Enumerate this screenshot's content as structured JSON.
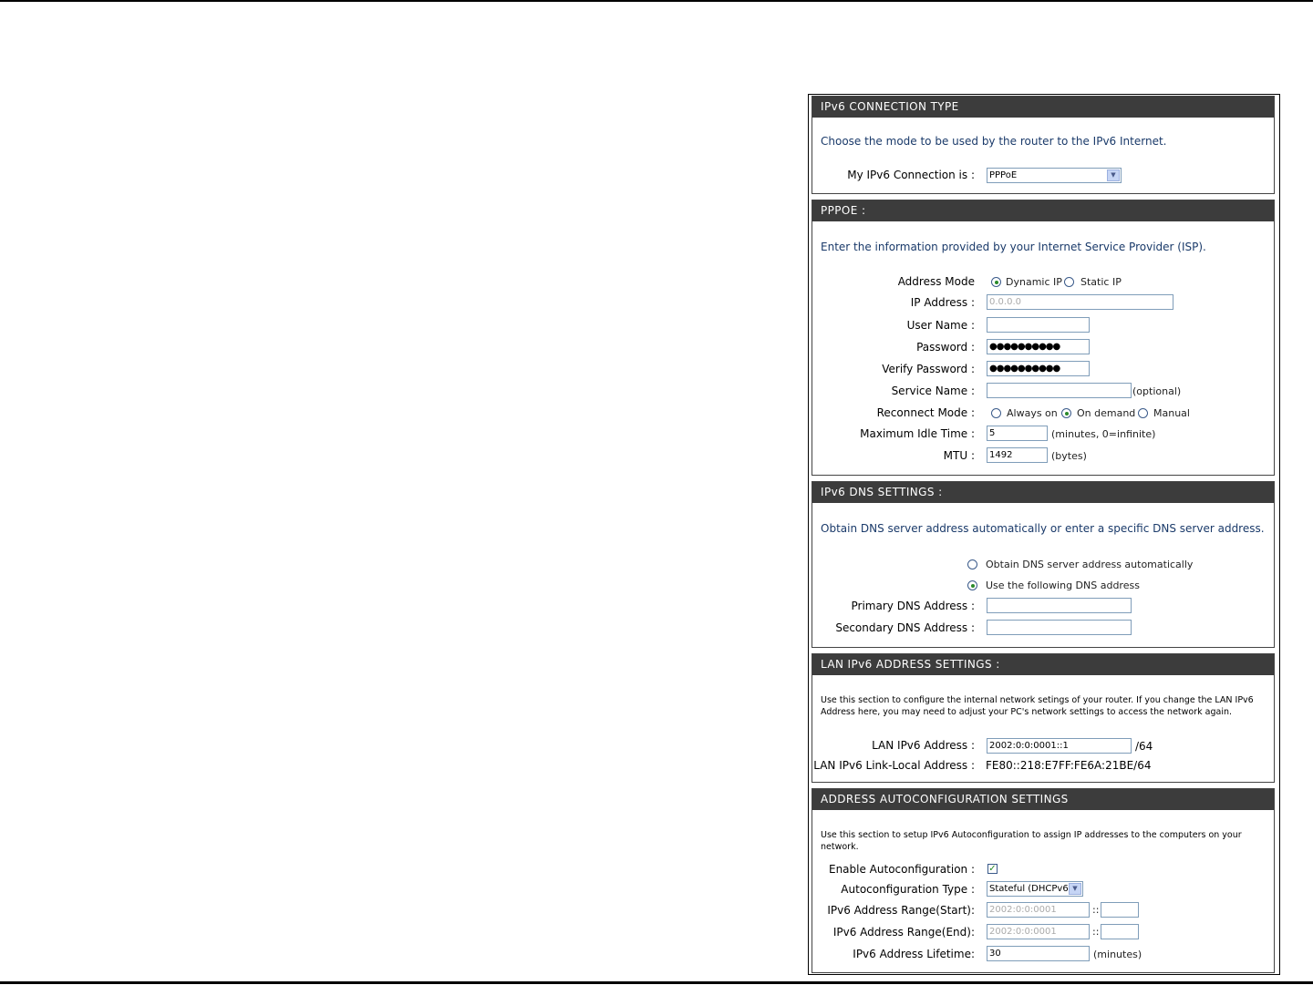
{
  "connection_type": {
    "header": "IPv6 CONNECTION TYPE",
    "intro": "Choose the mode to be used by the router to the IPv6 Internet.",
    "label": "My IPv6 Connection is :",
    "value": "PPPoE"
  },
  "pppoe": {
    "header": "PPPOE :",
    "intro": "Enter the information provided by your Internet Service Provider (ISP).",
    "address_mode_label": "Address Mode",
    "address_mode_options": [
      "Dynamic IP",
      "Static IP"
    ],
    "address_mode_selected": "Dynamic IP",
    "ip_address_label": "IP Address :",
    "ip_address_value": "0.0.0.0",
    "user_name_label": "User Name :",
    "user_name_value": "",
    "password_label": "Password :",
    "password_value": "●●●●●●●●●●",
    "verify_password_label": "Verify Password :",
    "verify_password_value": "●●●●●●●●●●",
    "service_name_label": "Service Name :",
    "service_name_value": "",
    "service_name_hint": "(optional)",
    "reconnect_mode_label": "Reconnect Mode :",
    "reconnect_options": [
      "Always on",
      "On demand",
      "Manual"
    ],
    "reconnect_selected": "On demand",
    "max_idle_label": "Maximum Idle Time :",
    "max_idle_value": "5",
    "max_idle_hint": "(minutes, 0=infinite)",
    "mtu_label": "MTU :",
    "mtu_value": "1492",
    "mtu_hint": "(bytes)"
  },
  "dns": {
    "header": "IPv6 DNS SETTINGS :",
    "intro": "Obtain DNS server address automatically or enter a specific DNS server address.",
    "options": [
      "Obtain DNS server address automatically",
      "Use the following DNS address"
    ],
    "selected": "Use the following DNS address",
    "primary_label": "Primary DNS Address :",
    "primary_value": "",
    "secondary_label": "Secondary DNS Address :",
    "secondary_value": ""
  },
  "lan": {
    "header": "LAN IPv6 ADDRESS SETTINGS :",
    "intro": "Use this section to configure the internal network setings of your router. If you change the LAN IPv6 Address here, you may need to adjust your PC's network settings to access the network again.",
    "address_label": "LAN IPv6 Address :",
    "address_value": "2002:0:0:0001::1",
    "prefix": "/64",
    "link_local_label": "LAN IPv6 Link-Local Address :",
    "link_local_value": "FE80::218:E7FF:FE6A:21BE/64"
  },
  "autoconf": {
    "header": "ADDRESS AUTOCONFIGURATION SETTINGS",
    "intro": "Use this section to setup IPv6 Autoconfiguration to assign IP addresses to the computers on your network.",
    "enable_label": "Enable Autoconfiguration :",
    "enable_checked": true,
    "type_label": "Autoconfiguration Type :",
    "type_value": "Stateful (DHCPv6)",
    "range_start_label": "IPv6 Address Range(Start):",
    "range_start_prefix": "2002:0:0:0001",
    "range_start_suffix": "",
    "range_end_label": "IPv6 Address Range(End):",
    "range_end_prefix": "2002:0:0:0001",
    "range_end_suffix": "",
    "separator": "::",
    "lifetime_label": "IPv6 Address Lifetime:",
    "lifetime_value": "30",
    "lifetime_hint": "(minutes)"
  },
  "icons": {
    "dropdown": "chevron-down-icon",
    "check": "check-icon"
  }
}
